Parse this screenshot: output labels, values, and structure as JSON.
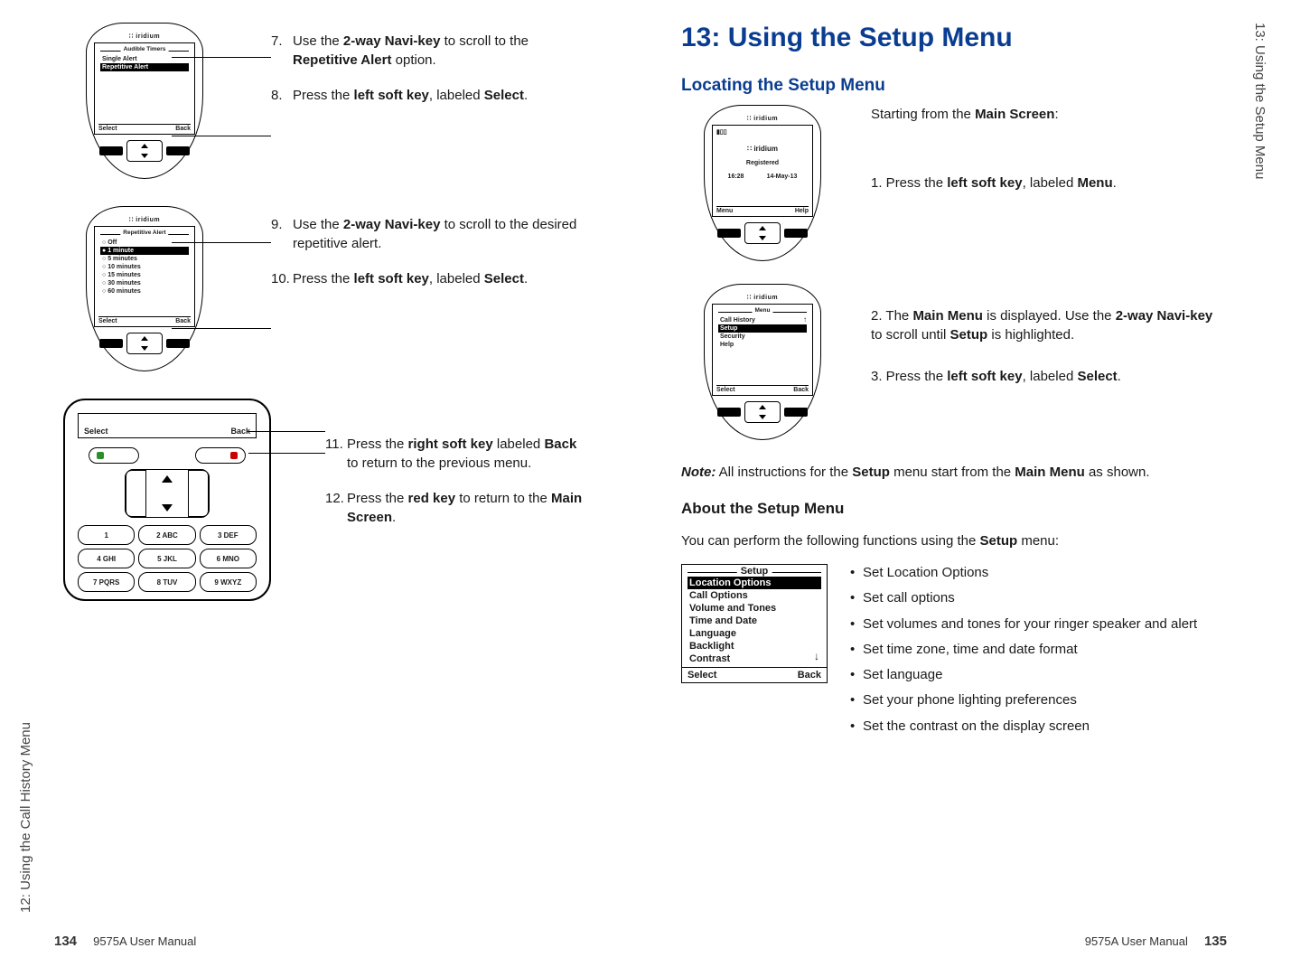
{
  "left_page": {
    "sidetab": "12: Using the Call History Menu",
    "footer_num": "134",
    "footer_text": "9575A User Manual",
    "phone_brand": "iridium",
    "screen1": {
      "group_title": "Audible Timers",
      "item1": "Single Alert",
      "item2_sel": "Repetitive Alert",
      "sk_left": "Select",
      "sk_right": "Back"
    },
    "steps_a": {
      "s7_num": "7.",
      "s7_p1": "Use the ",
      "s7_b1": "2-way Navi-key",
      "s7_p2": " to scroll to the ",
      "s7_b2": "Repetitive Alert",
      "s7_p3": " option.",
      "s8_num": "8.",
      "s8_p1": "Press the ",
      "s8_b1": "left soft key",
      "s8_p2": ", labeled ",
      "s8_b2": "Select",
      "s8_p3": "."
    },
    "screen2": {
      "group_title": "Repetitive Alert",
      "opt1": "Off",
      "opt2_sel": "1 minute",
      "opt3": "5 minutes",
      "opt4": "10 minutes",
      "opt5": "15 minutes",
      "opt6": "30 minutes",
      "opt7": "60 minutes",
      "sk_left": "Select",
      "sk_right": "Back"
    },
    "steps_b": {
      "s9_num": "9.",
      "s9_p1": "Use the ",
      "s9_b1": "2-way Navi-key",
      "s9_p2": " to scroll to the desired repetitive alert.",
      "s10_num": "10.",
      "s10_p1": "Press the ",
      "s10_b1": "left soft key",
      "s10_p2": ", labeled ",
      "s10_b2": "Select",
      "s10_p3": "."
    },
    "screen3": {
      "sk_left": "Select",
      "sk_right": "Back",
      "k1": "1",
      "k2": "2 ABC",
      "k3": "3 DEF",
      "k4": "4 GHI",
      "k5": "5 JKL",
      "k6": "6 MNO",
      "k7": "7 PQRS",
      "k8": "8 TUV",
      "k9": "9 WXYZ"
    },
    "steps_c": {
      "s11_num": "11.",
      "s11_p1": "Press the ",
      "s11_b1": "right soft key",
      "s11_p2": " labeled ",
      "s11_b2": "Back",
      "s11_p3": " to return to the previous menu.",
      "s12_num": "12.",
      "s12_p1": "Press the ",
      "s12_b1": "red key",
      "s12_p2": " to return to the ",
      "s12_b2": "Main Screen",
      "s12_p3": "."
    }
  },
  "right_page": {
    "sidetab": "13: Using the Setup Menu",
    "footer_text": "9575A User Manual",
    "footer_num": "135",
    "chapter": "13:  Using the Setup Menu",
    "section1": "Locating the Setup Menu",
    "phone_brand": "iridium",
    "mainscreen": {
      "logo": "∷ iridium",
      "registered": "Registered",
      "time": "16:28",
      "date": "14-May-13",
      "sk_left": "Menu",
      "sk_right": "Help"
    },
    "start_p1": "Starting from the ",
    "start_b": "Main Screen",
    "start_p2": ":",
    "step1_num": "1.",
    "step1_p1": " Press the ",
    "step1_b1": "left soft key",
    "step1_p2": ", labeled ",
    "step1_b2": "Menu",
    "step1_p3": ".",
    "menuscreen": {
      "group_title": "Menu",
      "item1": "Call History",
      "item2_sel": "Setup",
      "item3": "Security",
      "item4": "Help",
      "sk_left": "Select",
      "sk_right": "Back"
    },
    "step2_num": "2.",
    "step2_p1": " The ",
    "step2_b1": "Main Menu",
    "step2_p2": " is displayed. Use the ",
    "step2_b2": "2-way Navi-key",
    "step2_p3": " to scroll until ",
    "step2_b3": "Setup",
    "step2_p4": " is highlighted.",
    "step3_num": "3.",
    "step3_p1": " Press the ",
    "step3_b1": "left soft key",
    "step3_p2": ", labeled ",
    "step3_b2": "Select",
    "step3_p3": ".",
    "note_b": "Note:",
    "note_p1": " All instructions for the ",
    "note_b2": "Setup",
    "note_p2": " menu start from the ",
    "note_b3": "Main Menu",
    "note_p3": " as shown.",
    "section2": "About the Setup Menu",
    "about_p1": "You can perform the following functions using the ",
    "about_b": "Setup",
    "about_p2": " menu:",
    "setupbox": {
      "title": "Setup",
      "i1_sel": "Location Options",
      "i2": "Call Options",
      "i3": "Volume and Tones",
      "i4": "Time and Date",
      "i5": "Language",
      "i6": "Backlight",
      "i7": "Contrast",
      "sk_left": "Select",
      "sk_right": "Back"
    },
    "bullets": {
      "b1": "Set Location Options",
      "b2": "Set call options",
      "b3": "Set volumes and tones for your ringer speaker and alert",
      "b4": "Set time zone, time and date format",
      "b5": "Set language",
      "b6": "Set your phone lighting preferences",
      "b7": "Set the contrast on the display screen"
    }
  }
}
